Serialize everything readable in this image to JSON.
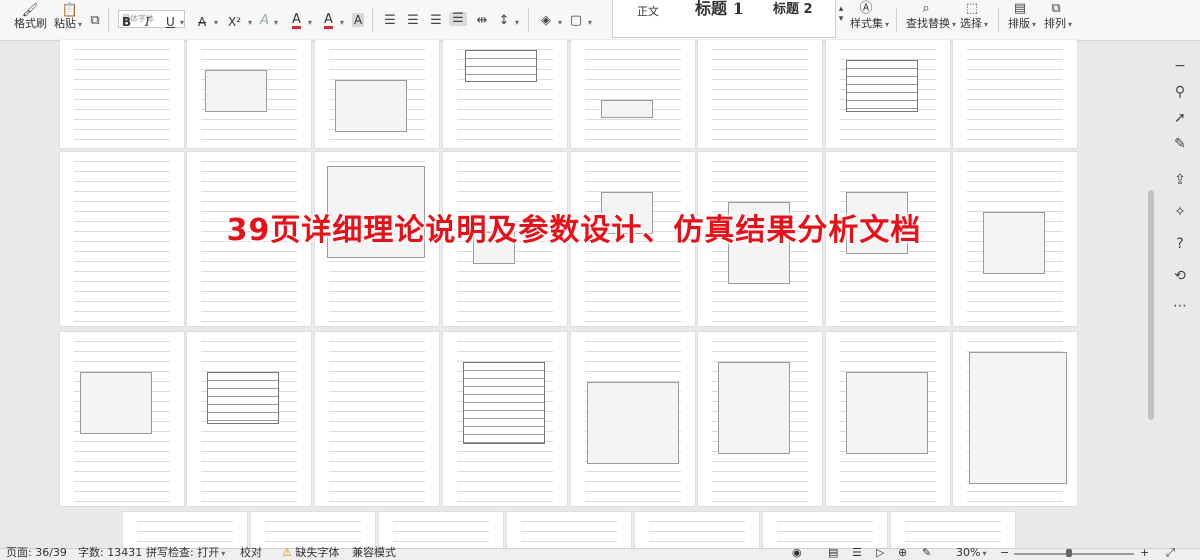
{
  "ribbon": {
    "format_painter": "格式刷",
    "paste": "粘贴",
    "font_placeholder": "黑体字体",
    "bold": "B",
    "italic": "I",
    "underline": "U",
    "strike": "A",
    "superscript": "X²",
    "font_color": "A",
    "highlight": "A",
    "char_shading": "A",
    "style_normal": "正文",
    "style_h1": "标题 1",
    "style_h2": "标题 2",
    "style_set": "样式集",
    "find_replace": "查找替换",
    "select": "选择",
    "layout": "排版",
    "arrange": "排列"
  },
  "overlay": {
    "text": "39页详细理论说明及参数设计、仿真结果分析文档"
  },
  "status": {
    "page": "页面: 36/39",
    "words": "字数: 13431",
    "spell": "拼写检查: 打开",
    "proof": "校对",
    "missing_font": "缺失字体",
    "compat": "兼容模式",
    "zoom": "30%"
  },
  "colors": {
    "overlay_red": "#e8111a",
    "font_color_red": "#d9262c",
    "accent_blue": "#2b62d9"
  }
}
